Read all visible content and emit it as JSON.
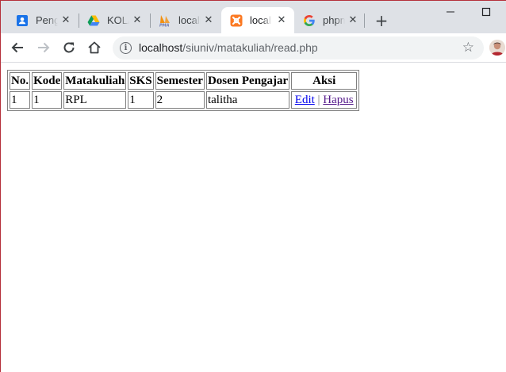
{
  "browser": {
    "tabs": [
      {
        "title": "Pengguna",
        "icon": "contacts-icon",
        "active": false
      },
      {
        "title": "KOLAB",
        "icon": "google-drive-icon",
        "active": false
      },
      {
        "title": "localhost",
        "icon": "phpmyadmin-icon",
        "active": false
      },
      {
        "title": "localhost",
        "icon": "xampp-icon",
        "active": true
      },
      {
        "title": "phpmyadmin",
        "icon": "google-icon",
        "active": false
      }
    ],
    "address": {
      "host": "localhost",
      "path": "/siuniv/matakuliah/read.php"
    },
    "colors": {
      "accent": "#1a73e8",
      "frame": "#dee1e6",
      "frame_border": "#b5303a"
    }
  },
  "table": {
    "headers": [
      "No.",
      "Kode",
      "Matakuliah",
      "SKS",
      "Semester",
      "Dosen Pengajar",
      "Aksi"
    ],
    "rows": [
      {
        "no": "1",
        "kode": "1",
        "matakuliah": "RPL",
        "sks": "1",
        "semester": "2",
        "dosen": "talitha",
        "edit_label": "Edit",
        "separator": "|",
        "delete_label": "Hapus"
      }
    ]
  }
}
